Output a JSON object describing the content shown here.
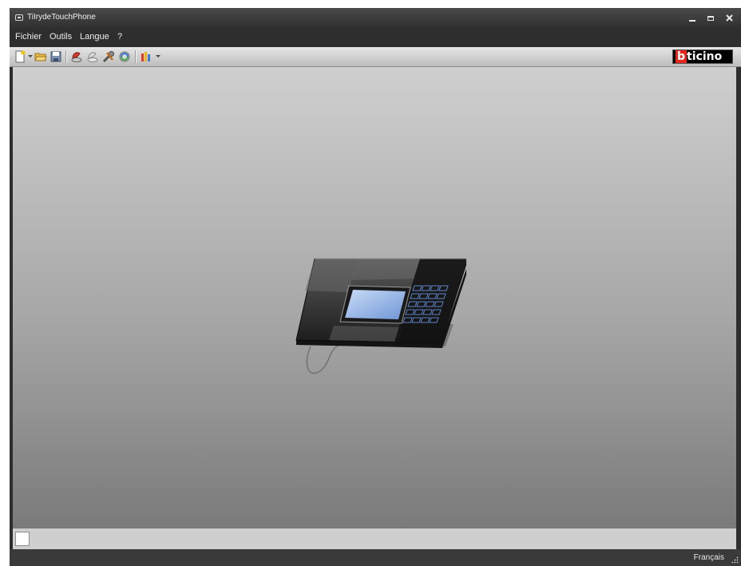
{
  "window": {
    "title": "TiIrydeTouchPhone"
  },
  "title_controls": {
    "minimize": "minimize",
    "maximize": "maximize",
    "close": "close"
  },
  "menu": {
    "items": [
      "Fichier",
      "Outils",
      "Langue",
      "?"
    ]
  },
  "toolbar": {
    "icons": [
      "new-document-icon",
      "open-folder-icon",
      "save-icon",
      "device-red-icon",
      "device-gray-icon",
      "tools-icon",
      "sync-icon",
      "palette-icon"
    ],
    "brand": {
      "prefix": "b",
      "rest": "ticino",
      "prefix_color": "#e5261d"
    }
  },
  "canvas": {
    "device_name": "touch-phone-device"
  },
  "status": {
    "language": "Français"
  },
  "colors": {
    "titlebar": "#3a3a3a",
    "menubar": "#2e2e2e",
    "toolbar": "#d6d6d6",
    "canvas_top": "#cfcfcf",
    "canvas_bottom": "#7a7a7a",
    "accent": "#e5261d"
  }
}
